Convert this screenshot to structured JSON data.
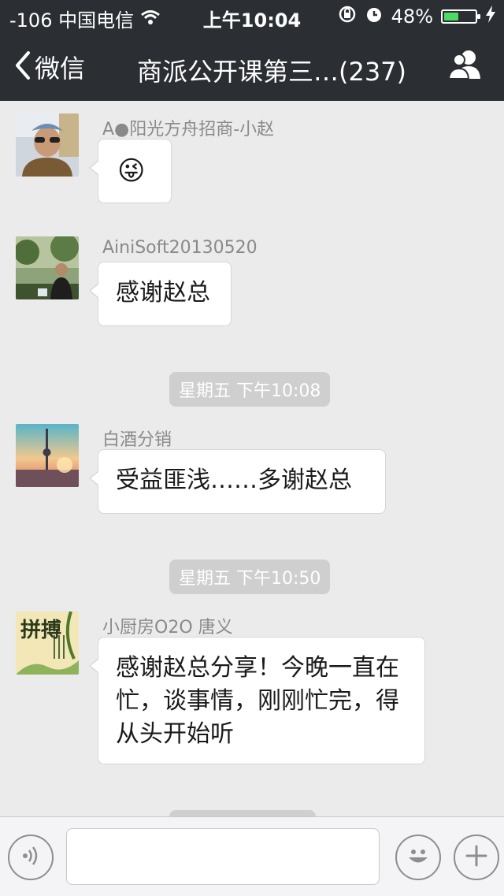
{
  "status_bar": {
    "carrier": "-106 中国电信",
    "time": "上午10:04",
    "battery_text": "48%",
    "battery_level": 0.48,
    "icons": [
      "wifi-icon",
      "rotation-lock-icon",
      "alarm-icon",
      "battery-icon",
      "charging-icon"
    ]
  },
  "nav": {
    "back_label": "微信",
    "title": "商派公开课第三…(237)",
    "icons": [
      "chevron-left-icon",
      "group-members-icon"
    ]
  },
  "messages": [
    {
      "sender": "A●阳光方舟招商-小赵",
      "text": "😜",
      "avatar": "avatar-man-sunglasses"
    },
    {
      "sender": "AiniSoft20130520",
      "text": "感谢赵总",
      "avatar": "avatar-man-garden"
    },
    {
      "time": "星期五 下午10:08"
    },
    {
      "sender": "白酒分销",
      "text": "受益匪浅……多谢赵总",
      "avatar": "avatar-tower-sunset"
    },
    {
      "time": "星期五 下午10:50"
    },
    {
      "sender": "小厨房O2O 唐义",
      "text": "感谢赵总分享！今晚一直在忙，谈事情，刚刚忙完，得从头开始听",
      "avatar": "avatar-calligraphy-pinbo"
    }
  ],
  "avatar_texts": {
    "calligraphy": "拼搏"
  },
  "input_bar": {
    "text_value": "",
    "icons": [
      "voice-icon",
      "emoji-icon",
      "plus-icon"
    ]
  },
  "colors": {
    "header_bg": "#2b2e33",
    "chat_bg": "#ebebeb",
    "bubble_bg": "#ffffff",
    "time_pill_bg": "#cfcfcf",
    "battery_fill": "#4cd964"
  }
}
